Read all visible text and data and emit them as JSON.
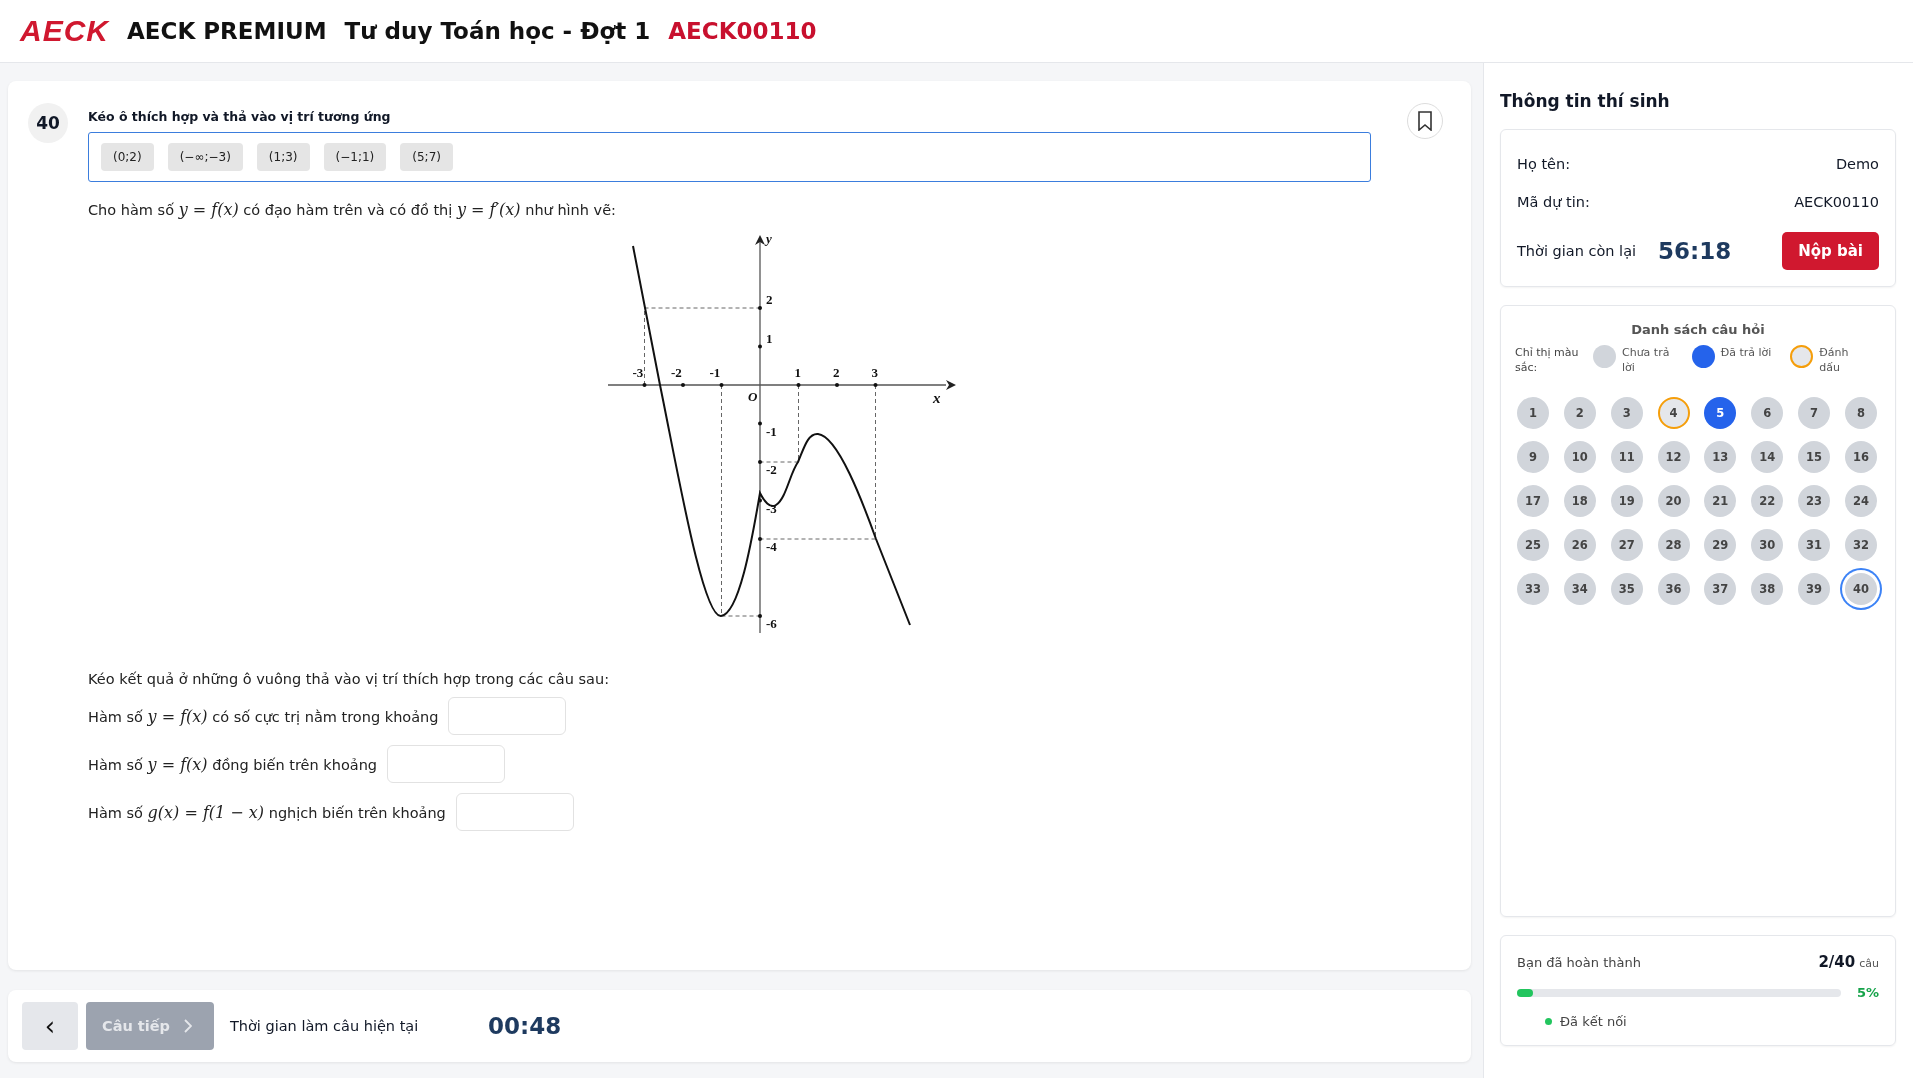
{
  "header": {
    "brand": "AECK",
    "product": "AECK PREMIUM",
    "exam": "Tư duy Toán học - Đợt 1",
    "code": "AECK00110"
  },
  "question": {
    "number": "40",
    "instruction": "Kéo ô thích hợp và thả vào vị trí tương ứng",
    "bookmarked": false,
    "options": [
      "(0;2)",
      "(−∞;−3)",
      "(1;3)",
      "(−1;1)",
      "(5;7)"
    ],
    "intro": [
      {
        "kind": "text",
        "s": "Cho hàm số "
      },
      {
        "kind": "math",
        "s": "y = f(x)"
      },
      {
        "kind": "text",
        "s": " có đạo hàm trên và có đồ thị "
      },
      {
        "kind": "math",
        "s": "y = f′(x)"
      },
      {
        "kind": "text",
        "s": " như hình vẽ:"
      }
    ],
    "graph": {
      "axis_x": "x",
      "axis_y": "y",
      "origin": "O",
      "x_labels": [
        "-3",
        "-2",
        "-1",
        "1",
        "2",
        "3"
      ],
      "y_labels": [
        "2",
        "1",
        "-1",
        "-2",
        "-3",
        "-4",
        "-6"
      ]
    },
    "prompt": "Kéo kết quả ở những ô vuông thả vào vị trí thích hợp trong các câu sau:",
    "sentences": [
      [
        {
          "kind": "text",
          "s": "Hàm số "
        },
        {
          "kind": "math",
          "s": "y = f(x)"
        },
        {
          "kind": "text",
          "s": " có số cực trị nằm trong khoảng"
        }
      ],
      [
        {
          "kind": "text",
          "s": "Hàm số "
        },
        {
          "kind": "math",
          "s": "y = f(x)"
        },
        {
          "kind": "text",
          "s": " đồng biến trên khoảng"
        }
      ],
      [
        {
          "kind": "text",
          "s": "Hàm số "
        },
        {
          "kind": "math",
          "s": "g(x) = f(1 − x)"
        },
        {
          "kind": "text",
          "s": " nghịch biến trên khoảng"
        }
      ]
    ]
  },
  "footer": {
    "prev": "‹",
    "next": "Câu tiếp",
    "next_disabled": true,
    "timer_label": "Thời gian làm câu hiện tại",
    "timer": "00:48"
  },
  "candidate": {
    "title": "Thông tin thí sinh",
    "name_label": "Họ tên:",
    "name": "Demo",
    "id_label": "Mã dự tin:",
    "id": "AECK00110",
    "time_label": "Thời gian còn lại",
    "time": "56:18",
    "submit": "Nộp bài"
  },
  "question_list": {
    "title": "Danh sách câu hỏi",
    "legend_label": "Chỉ thị màu sắc:",
    "legend": [
      {
        "kind": "unanswered",
        "label": "Chưa trả lời"
      },
      {
        "kind": "answered",
        "label": "Đã trả lời"
      },
      {
        "kind": "marked",
        "label": "Đánh dấu"
      }
    ],
    "items": [
      {
        "n": "1",
        "answered": false,
        "marked": false,
        "selected": false
      },
      {
        "n": "2",
        "answered": false,
        "marked": false,
        "selected": false
      },
      {
        "n": "3",
        "answered": false,
        "marked": false,
        "selected": false
      },
      {
        "n": "4",
        "answered": false,
        "marked": true,
        "selected": false
      },
      {
        "n": "5",
        "answered": true,
        "marked": false,
        "selected": false
      },
      {
        "n": "6",
        "answered": false,
        "marked": false,
        "selected": false
      },
      {
        "n": "7",
        "answered": false,
        "marked": false,
        "selected": false
      },
      {
        "n": "8",
        "answered": false,
        "marked": false,
        "selected": false
      },
      {
        "n": "9",
        "answered": false,
        "marked": false,
        "selected": false
      },
      {
        "n": "10",
        "answered": false,
        "marked": false,
        "selected": false
      },
      {
        "n": "11",
        "answered": false,
        "marked": false,
        "selected": false
      },
      {
        "n": "12",
        "answered": false,
        "marked": false,
        "selected": false
      },
      {
        "n": "13",
        "answered": false,
        "marked": false,
        "selected": false
      },
      {
        "n": "14",
        "answered": false,
        "marked": false,
        "selected": false
      },
      {
        "n": "15",
        "answered": false,
        "marked": false,
        "selected": false
      },
      {
        "n": "16",
        "answered": false,
        "marked": false,
        "selected": false
      },
      {
        "n": "17",
        "answered": false,
        "marked": false,
        "selected": false
      },
      {
        "n": "18",
        "answered": false,
        "marked": false,
        "selected": false
      },
      {
        "n": "19",
        "answered": false,
        "marked": false,
        "selected": false
      },
      {
        "n": "20",
        "answered": false,
        "marked": false,
        "selected": false
      },
      {
        "n": "21",
        "answered": false,
        "marked": false,
        "selected": false
      },
      {
        "n": "22",
        "answered": false,
        "marked": false,
        "selected": false
      },
      {
        "n": "23",
        "answered": false,
        "marked": false,
        "selected": false
      },
      {
        "n": "24",
        "answered": false,
        "marked": false,
        "selected": false
      },
      {
        "n": "25",
        "answered": false,
        "marked": false,
        "selected": false
      },
      {
        "n": "26",
        "answered": false,
        "marked": false,
        "selected": false
      },
      {
        "n": "27",
        "answered": false,
        "marked": false,
        "selected": false
      },
      {
        "n": "28",
        "answered": false,
        "marked": false,
        "selected": false
      },
      {
        "n": "29",
        "answered": false,
        "marked": false,
        "selected": false
      },
      {
        "n": "30",
        "answered": false,
        "marked": false,
        "selected": false
      },
      {
        "n": "31",
        "answered": false,
        "marked": false,
        "selected": false
      },
      {
        "n": "32",
        "answered": false,
        "marked": false,
        "selected": false
      },
      {
        "n": "33",
        "answered": false,
        "marked": false,
        "selected": false
      },
      {
        "n": "34",
        "answered": false,
        "marked": false,
        "selected": false
      },
      {
        "n": "35",
        "answered": false,
        "marked": false,
        "selected": false
      },
      {
        "n": "36",
        "answered": false,
        "marked": false,
        "selected": false
      },
      {
        "n": "37",
        "answered": false,
        "marked": false,
        "selected": false
      },
      {
        "n": "38",
        "answered": false,
        "marked": false,
        "selected": false
      },
      {
        "n": "39",
        "answered": false,
        "marked": false,
        "selected": false
      },
      {
        "n": "40",
        "answered": false,
        "marked": false,
        "selected": true
      }
    ]
  },
  "progress": {
    "label": "Bạn đã hoàn thành",
    "count": "2/40",
    "unit": "câu",
    "level": 0.05,
    "percent": "5%",
    "connected": true,
    "connection": "Đã kết nối"
  }
}
